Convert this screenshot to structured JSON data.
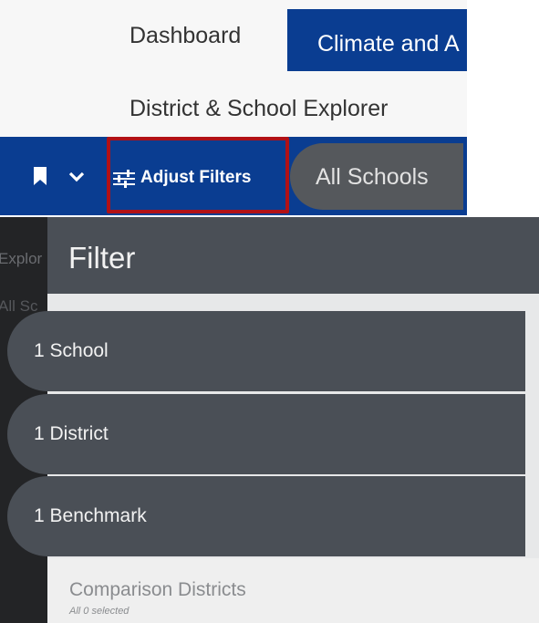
{
  "nav": {
    "dashboard": "Dashboard",
    "climate": "Climate and A",
    "explorer": "District & School Explorer"
  },
  "toolbar": {
    "adjust_filters": "Adjust Filters",
    "all_schools": "All Schools"
  },
  "background": {
    "explorer_fragment": "Explor",
    "all_schools_fragment": "All Sc"
  },
  "filter": {
    "title": "Filter",
    "items": [
      {
        "label": "1 School"
      },
      {
        "label": "1 District"
      },
      {
        "label": "1 Benchmark"
      }
    ],
    "comparison": {
      "title": "Comparison Districts",
      "subtitle": "All 0 selected"
    }
  },
  "colors": {
    "nav_blue": "#0a3d91",
    "highlight_red": "#b11116",
    "panel_dark": "#4a4f56"
  }
}
